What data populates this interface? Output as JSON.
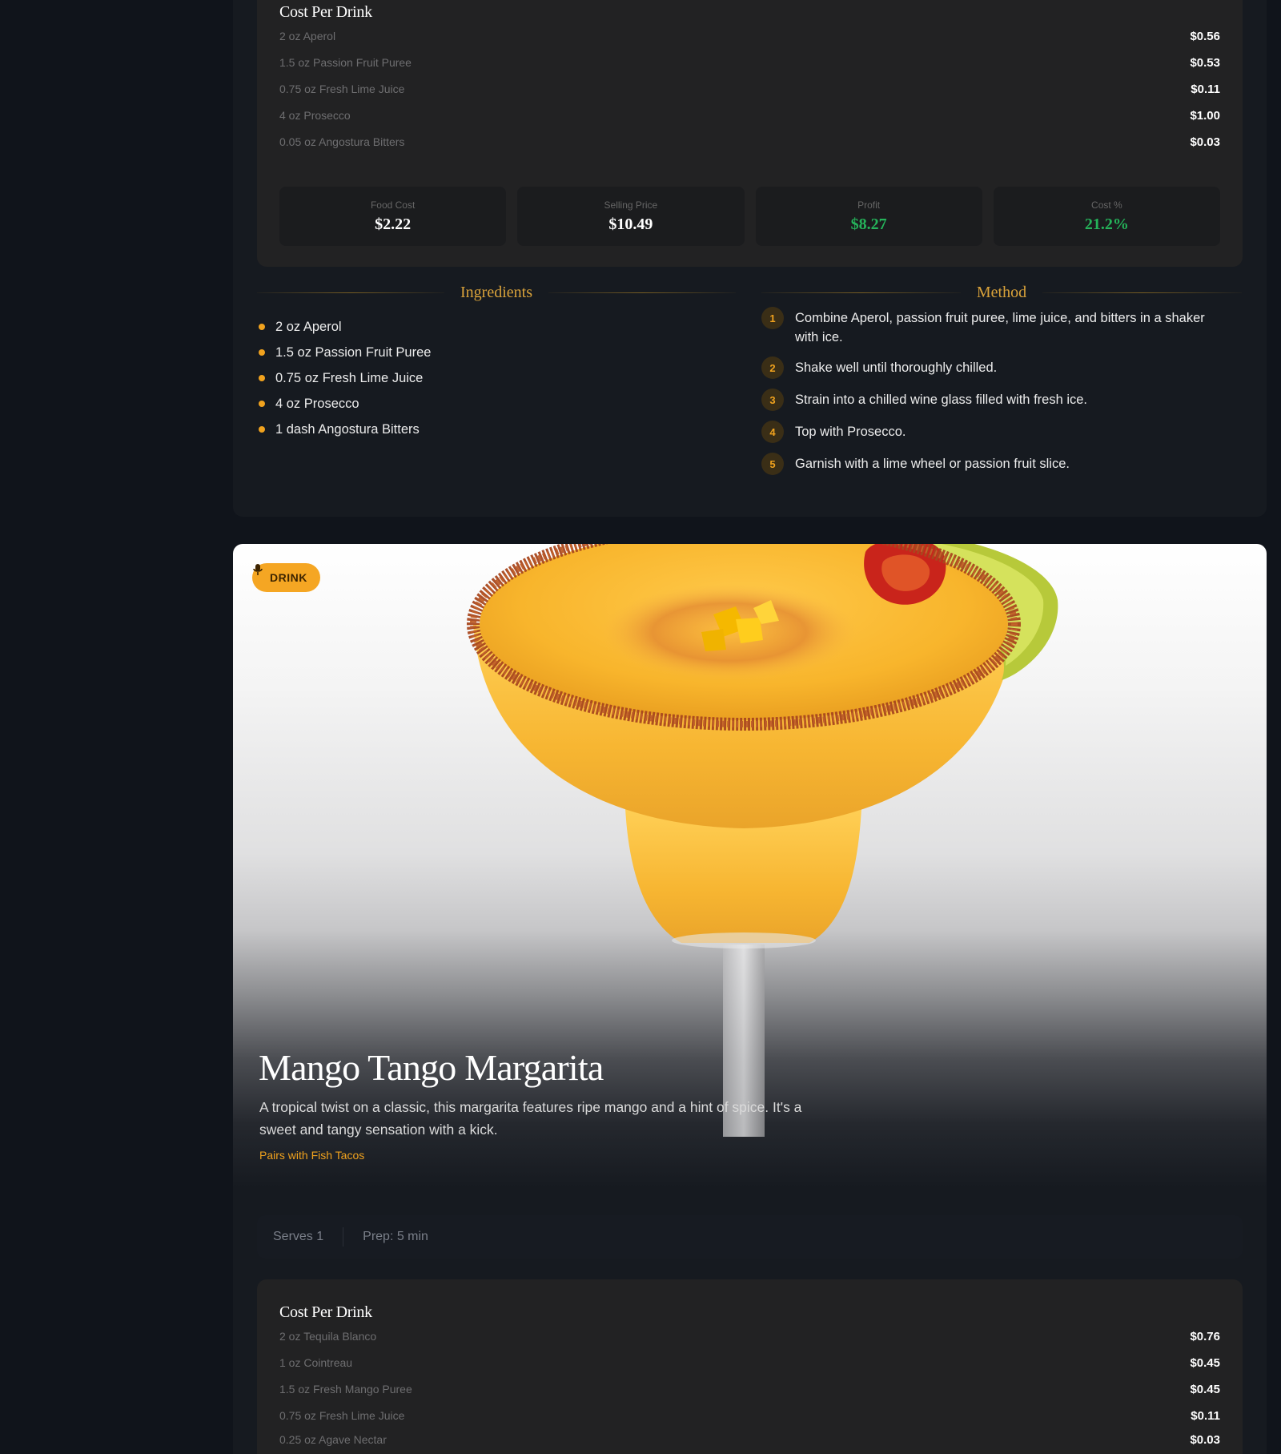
{
  "card1": {
    "cost_title": "Cost Per Drink",
    "cost_rows": [
      {
        "ingredient": "2 oz Aperol",
        "amount": "$0.56"
      },
      {
        "ingredient": "1.5 oz Passion Fruit Puree",
        "amount": "$0.53"
      },
      {
        "ingredient": "0.75 oz Fresh Lime Juice",
        "amount": "$0.11"
      },
      {
        "ingredient": "4 oz Prosecco",
        "amount": "$1.00"
      },
      {
        "ingredient": "0.05 oz Angostura Bitters",
        "amount": "$0.03"
      }
    ],
    "stats": [
      {
        "label": "Food Cost",
        "value": "$2.22"
      },
      {
        "label": "Selling Price",
        "value": "$10.49"
      },
      {
        "label": "Profit",
        "value": "$8.27"
      },
      {
        "label": "Cost %",
        "value": "21.2%"
      }
    ],
    "ingredients_heading": "Ingredients",
    "method_heading": "Method",
    "ingredients": [
      "2 oz Aperol",
      "1.5 oz Passion Fruit Puree",
      "0.75 oz Fresh Lime Juice",
      "4 oz Prosecco",
      "1 dash Angostura Bitters"
    ],
    "steps": [
      {
        "num": "1",
        "text": "Combine Aperol, passion fruit puree, lime juice, and bitters in a shaker with ice."
      },
      {
        "num": "2",
        "text": "Shake well until thoroughly chilled."
      },
      {
        "num": "3",
        "text": "Strain into a chilled wine glass filled with fresh ice."
      },
      {
        "num": "4",
        "text": "Top with Prosecco."
      },
      {
        "num": "5",
        "text": "Garnish with a lime wheel or passion fruit slice."
      }
    ]
  },
  "card2": {
    "badge_label": "DRINK",
    "badge_icon": "microphone-icon",
    "title": "Mango Tango Margarita",
    "description": "A tropical twist on a classic, this margarita features ripe mango and a hint of spice. It's a sweet and tangy sensation with a kick.",
    "pairing": "Pairs with Fish Tacos",
    "serves": "Serves 1",
    "prep": "Prep: 5 min",
    "cost_title": "Cost Per Drink",
    "cost_rows": [
      {
        "ingredient": "2 oz Tequila Blanco",
        "amount": "$0.76"
      },
      {
        "ingredient": "1 oz Cointreau",
        "amount": "$0.45"
      },
      {
        "ingredient": "1.5 oz Fresh Mango Puree",
        "amount": "$0.45"
      },
      {
        "ingredient": "0.75 oz Fresh Lime Juice",
        "amount": "$0.11"
      },
      {
        "ingredient": "0.25 oz Agave Nectar",
        "amount": "$0.03"
      }
    ]
  },
  "colors": {
    "accent": "#f0a21e",
    "profit_green": "#25b35a",
    "background": "#10141b",
    "card": "#161a20",
    "panel": "#222223"
  }
}
